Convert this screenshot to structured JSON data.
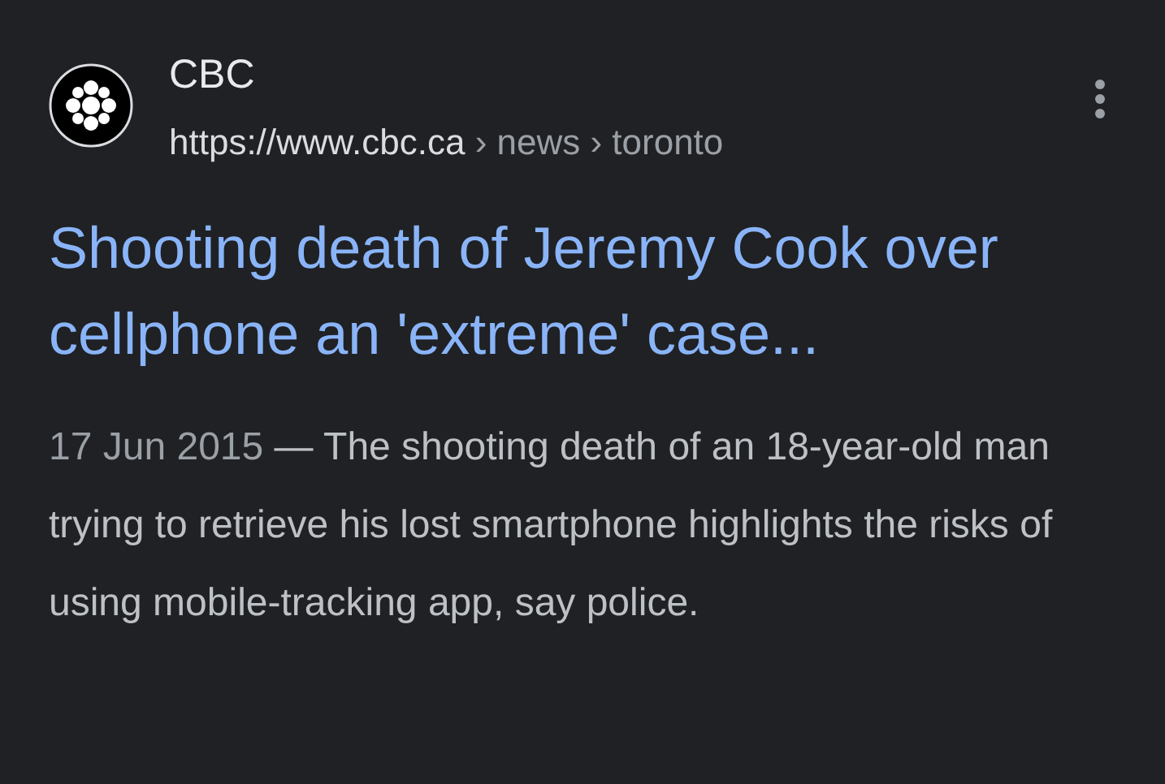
{
  "result": {
    "site_name": "CBC",
    "url_domain": "https://www.cbc.ca",
    "url_path": "› news › toronto",
    "title": "Shooting death of Jeremy Cook over cellphone an 'extreme' case...",
    "date": "17 Jun 2015",
    "snippet": "— The shooting death of an 18-year-old man trying to retrieve his lost smartphone highlights the risks of using mobile-tracking app, say police."
  }
}
